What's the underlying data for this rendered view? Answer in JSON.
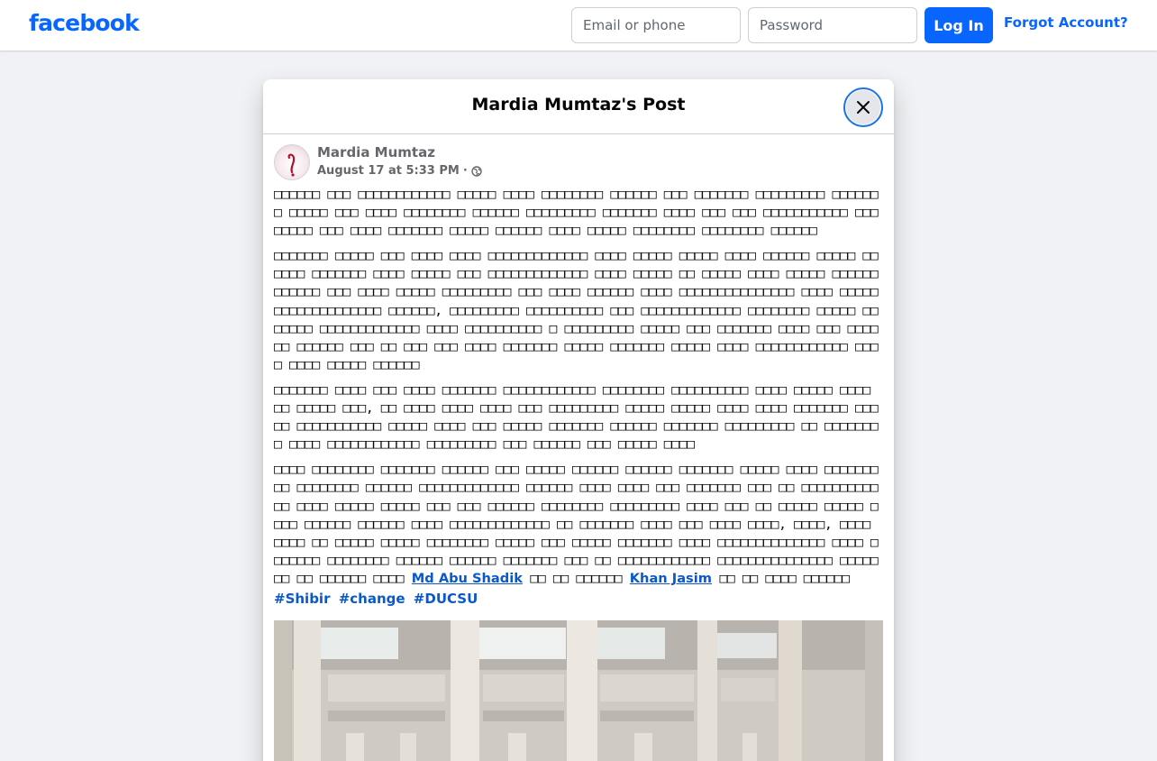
{
  "topbar": {
    "logo": "facebook",
    "email_placeholder": "Email or phone",
    "password_placeholder": "Password",
    "login_label": "Log In",
    "forgot_label": "Forgot Account?"
  },
  "modal": {
    "title": "Mardia Mumtaz's Post"
  },
  "post": {
    "author": "Mardia Mumtaz",
    "timestamp": "August 17 at 5:33 PM",
    "separator": "·",
    "paragraphs": [
      "□□□□□□ □□□ □□□□□□□□□□□□ □□□□□ □□□□ □□□□□□□□ □□□□□□ □□□ □□□□□□□ □□□□□□□□□ □□□□□□□ □□□□□ □□□ □□□□ □□□□□□□□ □□□□□□ □□□□□□□□□ □□□□□□□ □□□□ □□□ □□□ □□□□□□□□□□□ □□□□□□□□ □□□ □□□□ □□□□□□□ □□□□□ □□□□□□ □□□□ □□□□□ □□□□□□□□ □□□□□□□□ □□□□□□",
      "□□□□□□□ □□□□□ □□□ □□□□ □□□□ □□□□□□□□□□□□□ □□□□ □□□□□ □□□□□ □□□□ □□□□□□ □□□□□ □□□□□□ □□□□□□□ □□□□ □□□□□ □□□ □□□□□□□□□□□□□ □□□□ □□□□□ □□ □□□□□ □□□□ □□□□□ □□□□□□ □□□□□□ □□□ □□□□ □□□□□ □□□□□□□□□ □□□ □□□□ □□□□□□ □□□□ □□□□□□□□□□□□□□□ □□□□ □□□□□ □□□□□□□□□□□□□□ □□□□□□, □□□□□□□□□ □□□□□□□□□□ □□□ □□□□□□□□□□□□□ □□□□□□□□ □□□□□ □□□□□□□ □□□□□□□□□□□□□ □□□□ □□□□□□□□□□ □ □□□□□□□□□ □□□□□ □□□ □□□□□□□ □□□□ □□□ □□□□□□ □□□□□□ □□□ □□ □□□ □□□ □□□□ □□□□□□□ □□□□□ □□□□□□□ □□□□□ □□□□ □□□□□□□□□□□□ □□□□ □□□□ □□□□□ □□□□□□",
      "□□□□□□□ □□□□ □□□ □□□□ □□□□□□□ □□□□□□□□□□□□ □□□□□□□□ □□□□□□□□□□ □□□□ □□□□□ □□□□ □□ □□□□□ □□□, □□ □□□□ □□□□ □□□□ □□□ □□□□□□□□□ □□□□□ □□□□□ □□□□ □□□□ □□□□□□□ □□□□□ □□□□□□□□□□□ □□□□□ □□□□ □□□ □□□□□ □□□□□□□ □□□□□□ □□□□□□□ □□□□□□□□□ □□ □□□□□□□□ □□□□ □□□□□□□□□□□□ □□□□□□□□□ □□□ □□□□□□ □□□ □□□□□ □□□□",
      "□□□□ □□□□□□□□ □□□□□□□ □□□□□□ □□□ □□□□□ □□□□□□ □□□□□□ □□□□□□□ □□□□□ □□□□ □□□□□□□□□ □□□□□□□□ □□□□□□ □□□□□□□□□□□□□ □□□□□□ □□□□ □□□□ □□□ □□□□□□□ □□□ □□ □□□□□□□□□□□□ □□□□ □□□□□ □□□□□ □□□ □□□ □□□□□□ □□□□□□□□ □□□□□□□□□ □□□□ □□□ □□ □□□□□ □□□□□ □□□□ □□□□□□ □□□□□□ □□□□ □□□□□□□□□□□□□ □□ □□□□□□□ □□□□ □□□ □□□□ □□□□, □□□□, □□□□ □□□□ □□ □□□□□ □□□□□ □□□□□□□□ □□□□□ □□□ □□□□□ □□□□□□□ □□□□ □□□□□□□□□□□□□□ □□□□ □□□□□□□ □□□□□□□□ □□□□□□ □□□□□□ □□□□□□□ □□□ □□ □□□□□□□□□□□□ □□□□□□□□□□□□□□□ □□□□□ □□ □□ □□□□□□ □□□□"
    ],
    "mention_1": "Md Abu Shadik",
    "between_mentions": "  □□ □□ □□□□□□ ",
    "mention_2": "Khan Jasim",
    "after_mentions": "  □□ □□ □□□□ □□□□□□",
    "hashtags": [
      "#Shibir",
      "#change",
      "#DUCSU"
    ]
  }
}
